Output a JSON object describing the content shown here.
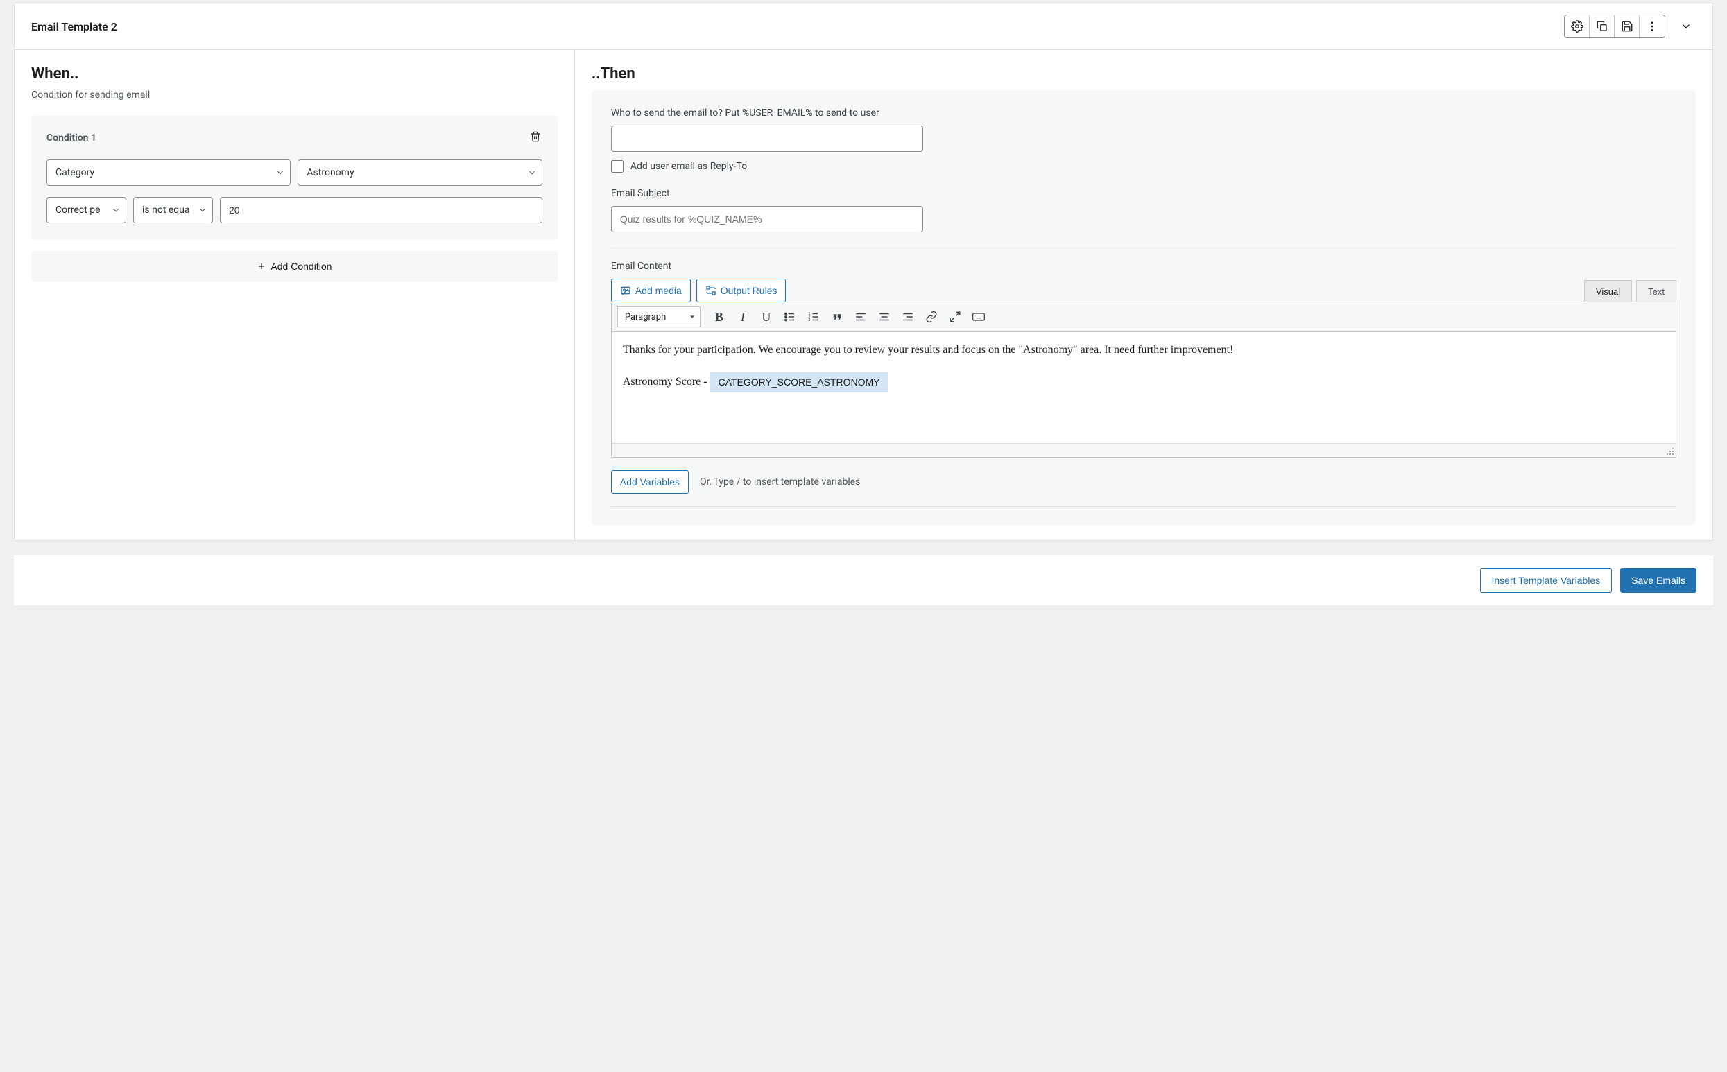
{
  "header": {
    "title": "Email Template 2"
  },
  "left": {
    "title": "When..",
    "subtitle": "Condition for sending email",
    "condition": {
      "label": "Condition 1",
      "row1_field": "Category",
      "row1_value": "Astronomy",
      "row2_field": "Correct pe",
      "row2_op": "is not equa",
      "row2_value": "20"
    },
    "add_condition": "Add Condition"
  },
  "right": {
    "title": "..Then",
    "to_label": "Who to send the email to? Put %USER_EMAIL% to send to user",
    "to_value": "",
    "reply_to_label": "Add user email as Reply-To",
    "subject_label": "Email Subject",
    "subject_placeholder": "Quiz results for %QUIZ_NAME%",
    "content_label": "Email Content",
    "add_media": "Add media",
    "output_rules": "Output Rules",
    "tabs": {
      "visual": "Visual",
      "text": "Text"
    },
    "format_label": "Paragraph",
    "body_p1": "Thanks for your participation. We encourage you to review your results and focus on the \"Astronomy\" area. It need further improvement!",
    "body_p2_prefix": "Astronomy Score - ",
    "body_p2_token": "CATEGORY_SCORE_ASTRONOMY",
    "add_variables": "Add Variables",
    "hint": "Or, Type / to insert template variables"
  },
  "footer": {
    "insert_vars": "Insert Template Variables",
    "save": "Save Emails"
  }
}
